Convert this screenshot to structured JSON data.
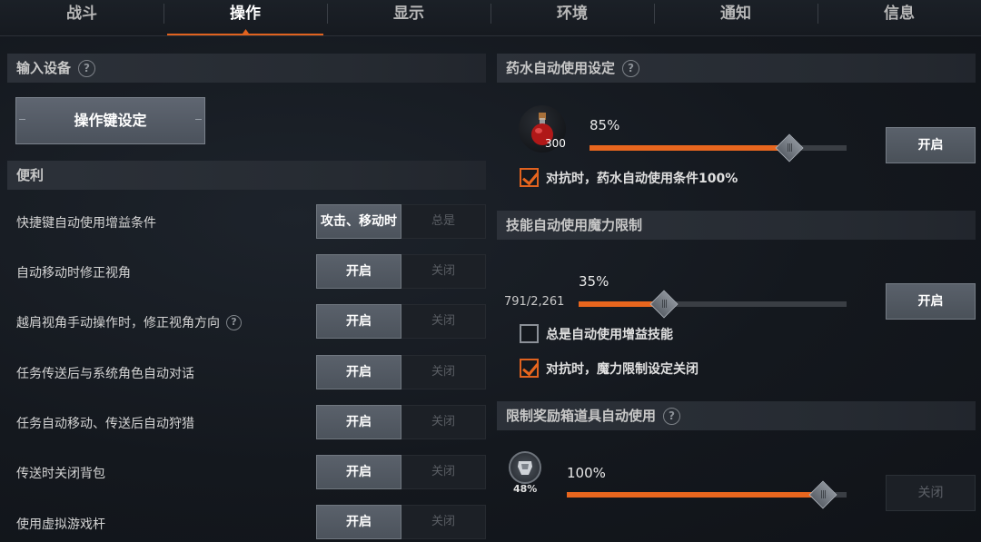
{
  "tabs": [
    {
      "label": "战斗",
      "active": false
    },
    {
      "label": "操作",
      "active": true
    },
    {
      "label": "显示",
      "active": false
    },
    {
      "label": "环境",
      "active": false
    },
    {
      "label": "通知",
      "active": false
    },
    {
      "label": "信息",
      "active": false
    }
  ],
  "left": {
    "input_section": {
      "title": "输入设备",
      "help": "?"
    },
    "keybind_button": "操作键设定",
    "convenience_section": {
      "title": "便利"
    },
    "rows": [
      {
        "label": "快捷键自动使用增益条件",
        "on": "攻击、移动时",
        "off": "总是"
      },
      {
        "label": "自动移动时修正视角",
        "on": "开启",
        "off": "关闭"
      },
      {
        "label": "越肩视角手动操作时，修正视角方向",
        "on": "开启",
        "off": "关闭",
        "help": "?"
      },
      {
        "label": "任务传送后与系统角色自动对话",
        "on": "开启",
        "off": "关闭"
      },
      {
        "label": "任务自动移动、传送后自动狩猎",
        "on": "开启",
        "off": "关闭"
      },
      {
        "label": "传送时关闭背包",
        "on": "开启",
        "off": "关闭"
      },
      {
        "label": "使用虚拟游戏杆",
        "on": "开启",
        "off": "关闭"
      }
    ]
  },
  "right": {
    "potion": {
      "title": "药水自动使用设定",
      "help": "?",
      "icon": "red-potion-icon",
      "count": "300",
      "percent_label": "85%",
      "value": 0.85,
      "button": "开启",
      "checkbox": {
        "label": "对抗时，药水自动使用条件100%",
        "checked": true
      }
    },
    "skill": {
      "title": "技能自动使用魔力限制",
      "mana": "791/2,261",
      "percent_label": "35%",
      "value": 0.35,
      "button": "开启",
      "checkbox1": {
        "label": "总是自动使用增益技能",
        "checked": false
      },
      "checkbox2": {
        "label": "对抗时，魔力限制设定关闭",
        "checked": true
      }
    },
    "reward": {
      "title": "限制奖励箱道具自动使用",
      "help": "?",
      "icon": "gauntlet-icon",
      "icon_percent": "48%",
      "percent_label": "100%",
      "value": 1.0,
      "button": "关闭"
    }
  },
  "colors": {
    "accent": "#e8661e",
    "panel": "#2a2f36"
  }
}
